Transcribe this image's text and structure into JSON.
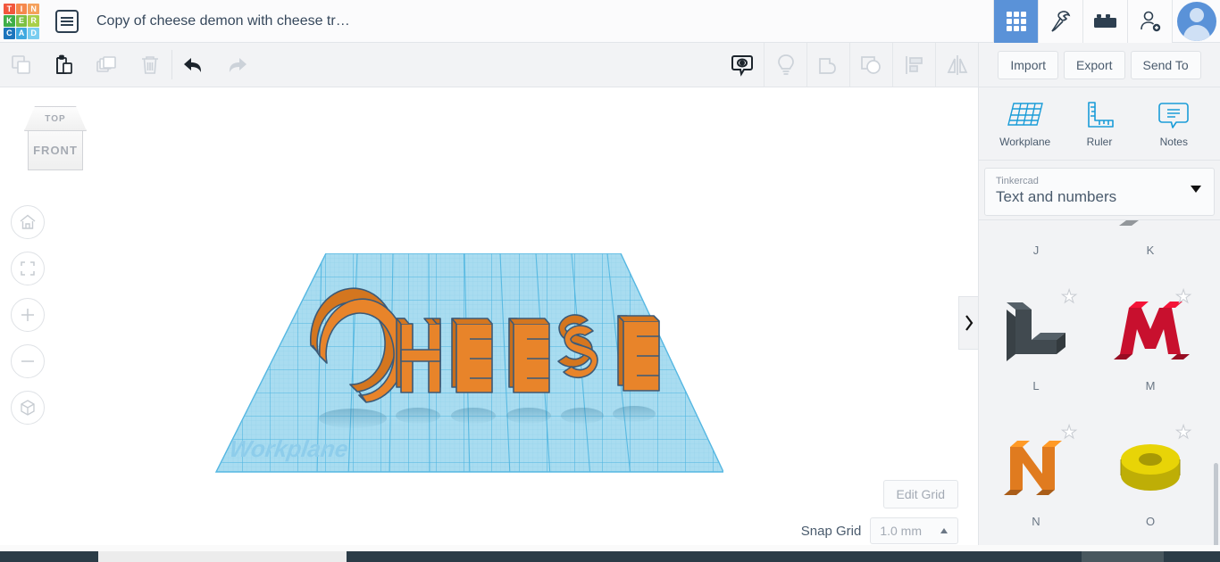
{
  "header": {
    "logo_cells": [
      {
        "letter": "T",
        "color": "#f1573d"
      },
      {
        "letter": "I",
        "color": "#f5884c"
      },
      {
        "letter": "N",
        "color": "#f5a15c"
      },
      {
        "letter": "K",
        "color": "#3fae49"
      },
      {
        "letter": "E",
        "color": "#7cc043"
      },
      {
        "letter": "R",
        "color": "#a9cf4a"
      },
      {
        "letter": "C",
        "color": "#1c75bc"
      },
      {
        "letter": "A",
        "color": "#3fa9e0"
      },
      {
        "letter": "D",
        "color": "#79cdf0"
      }
    ],
    "doc_menu_icon": "list-menu-icon",
    "title": "Copy of cheese demon with cheese tr…",
    "right_buttons": [
      {
        "name": "gallery-grid-icon",
        "active": true
      },
      {
        "name": "minecraft-pickaxe-icon",
        "active": false
      },
      {
        "name": "lego-brick-icon",
        "active": false
      },
      {
        "name": "add-user-icon",
        "active": false
      }
    ],
    "avatar": "user-avatar"
  },
  "toolbar": {
    "left_tools": [
      {
        "name": "copy-icon",
        "enabled": false
      },
      {
        "name": "paste-icon",
        "enabled": true
      },
      {
        "name": "duplicate-icon",
        "enabled": false
      },
      {
        "name": "delete-icon",
        "enabled": false
      }
    ],
    "history_tools": [
      {
        "name": "undo-icon",
        "enabled": true
      },
      {
        "name": "redo-icon",
        "enabled": false
      }
    ],
    "right_tools": [
      {
        "name": "show-hide-icon",
        "enabled": true
      },
      {
        "name": "light-bulb-icon",
        "enabled": false
      },
      {
        "name": "group-icon",
        "enabled": false
      },
      {
        "name": "ungroup-icon",
        "enabled": false
      },
      {
        "name": "align-icon",
        "enabled": false
      },
      {
        "name": "mirror-icon",
        "enabled": false
      }
    ]
  },
  "canvas": {
    "viewcube": {
      "top_label": "TOP",
      "front_label": "FRONT"
    },
    "nav_buttons": [
      {
        "name": "home-view-icon"
      },
      {
        "name": "fit-to-view-icon"
      },
      {
        "name": "zoom-in-icon"
      },
      {
        "name": "zoom-out-icon"
      },
      {
        "name": "perspective-toggle-icon"
      }
    ],
    "workplane_label": "Workplane",
    "model_text": "CHEESE",
    "model_color": "#e8842a",
    "model_outline": "#3b5a78",
    "grid_fill": "#a9dcf0",
    "grid_line": "#4cb4e0",
    "edit_grid_label": "Edit Grid",
    "snap_grid_label": "Snap Grid",
    "snap_grid_value": "1.0 mm",
    "collapse_tab_icon": "chevron-right-icon"
  },
  "panel": {
    "actions": [
      {
        "label": "Import",
        "name": "import-button"
      },
      {
        "label": "Export",
        "name": "export-button"
      },
      {
        "label": "Send To",
        "name": "send-to-button"
      }
    ],
    "tools": [
      {
        "label": "Workplane",
        "name": "workplane-tool",
        "icon": "workplane-grid-icon"
      },
      {
        "label": "Ruler",
        "name": "ruler-tool",
        "icon": "ruler-icon"
      },
      {
        "label": "Notes",
        "name": "notes-tool",
        "icon": "notes-callout-icon"
      }
    ],
    "dropdown": {
      "sublabel": "Tinkercad",
      "value": "Text and numbers",
      "arrow": "chevron-down-icon"
    },
    "shapes": [
      {
        "name": "J",
        "color": "#8c6239",
        "kind": "letter-j"
      },
      {
        "name": "K",
        "color": "#b3b8bd",
        "kind": "letter-k"
      },
      {
        "name": "L",
        "color": "#414a50",
        "kind": "letter-l"
      },
      {
        "name": "M",
        "color": "#c8102e",
        "kind": "letter-m"
      },
      {
        "name": "N",
        "color": "#e07b1f",
        "kind": "letter-n"
      },
      {
        "name": "O",
        "color": "#e8d407",
        "kind": "letter-o"
      }
    ],
    "favorite_icon": "star-outline-icon"
  }
}
